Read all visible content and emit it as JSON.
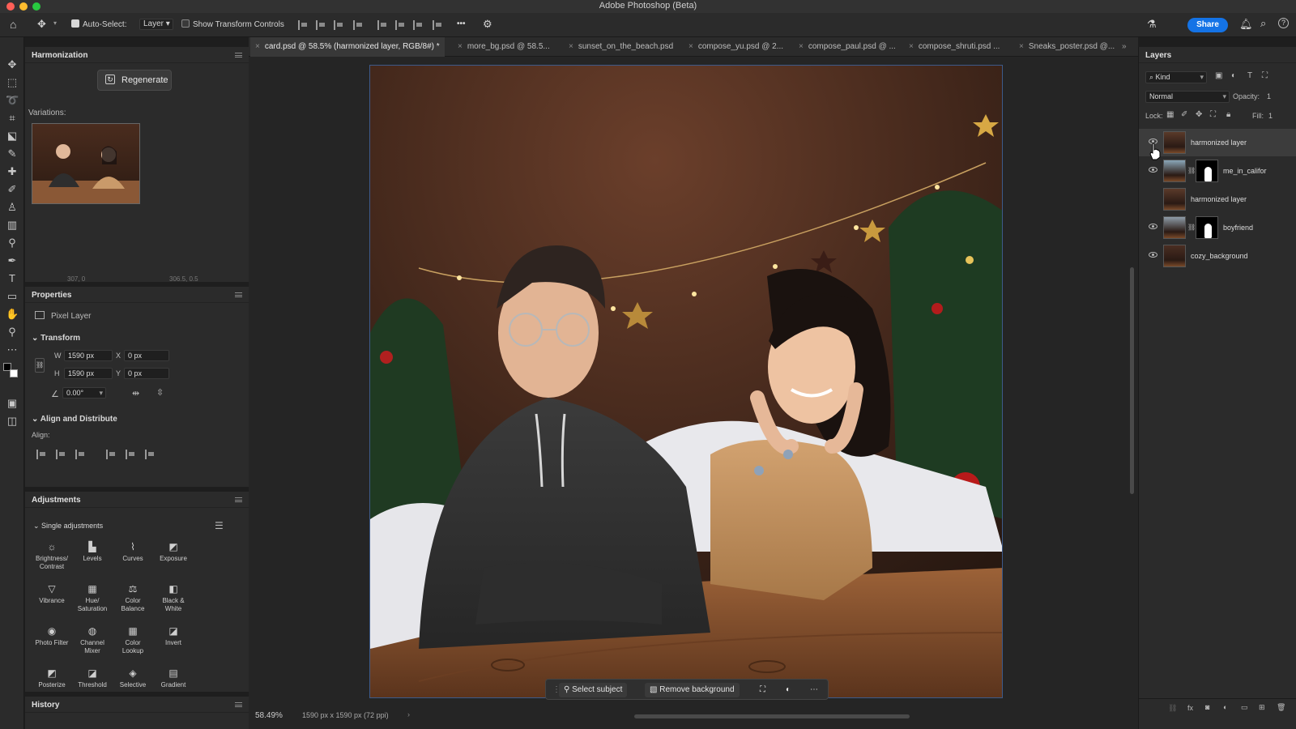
{
  "app": {
    "title": "Adobe Photoshop (Beta)"
  },
  "options": {
    "auto_select_label": "Auto-Select:",
    "auto_select_value": "Layer",
    "show_transform_label": "Show Transform Controls",
    "more": "•••",
    "share": "Share"
  },
  "tabs": [
    {
      "label": "card.psd @ 58.5% (harmonized layer, RGB/8#) *"
    },
    {
      "label": "more_bg.psd @ 58.5..."
    },
    {
      "label": "sunset_on_the_beach.psd"
    },
    {
      "label": "compose_yu.psd @ 2..."
    },
    {
      "label": "compose_paul.psd @ ..."
    },
    {
      "label": "compose_shruti.psd ..."
    },
    {
      "label": "Sneaks_poster.psd @..."
    }
  ],
  "harmonization": {
    "title": "Harmonization",
    "regenerate": "Regenerate",
    "variations": "Variations:",
    "coord_left": "307, 0",
    "coord_right": "306.5, 0.5"
  },
  "properties": {
    "title": "Properties",
    "layer_type": "Pixel Layer",
    "transform": "Transform",
    "w_label": "W",
    "w_value": "1590 px",
    "x_label": "X",
    "x_value": "0 px",
    "h_label": "H",
    "h_value": "1590 px",
    "y_label": "Y",
    "y_value": "0 px",
    "angle": "0.00°",
    "align_distribute": "Align and Distribute",
    "align": "Align:"
  },
  "adjustments": {
    "title": "Adjustments",
    "single": "Single adjustments",
    "items": [
      {
        "label": "Brightness/\nContrast",
        "icon": "☼"
      },
      {
        "label": "Levels",
        "icon": "▙"
      },
      {
        "label": "Curves",
        "icon": "⌇"
      },
      {
        "label": "Exposure",
        "icon": "◩"
      },
      {
        "label": "Vibrance",
        "icon": "▽"
      },
      {
        "label": "Hue/\nSaturation",
        "icon": "▦"
      },
      {
        "label": "Color\nBalance",
        "icon": "⚖"
      },
      {
        "label": "Black &\nWhite",
        "icon": "◧"
      },
      {
        "label": "Photo Filter",
        "icon": "◉"
      },
      {
        "label": "Channel\nMixer",
        "icon": "◍"
      },
      {
        "label": "Color\nLookup",
        "icon": "▦"
      },
      {
        "label": "Invert",
        "icon": "◪"
      },
      {
        "label": "Posterize",
        "icon": "◩"
      },
      {
        "label": "Threshold",
        "icon": "◪"
      },
      {
        "label": "Selective",
        "icon": "◈"
      },
      {
        "label": "Gradient",
        "icon": "▤"
      }
    ]
  },
  "history": {
    "title": "History"
  },
  "context_bar": {
    "select_subject": "Select subject",
    "remove_background": "Remove background"
  },
  "status": {
    "zoom": "58.49%",
    "doc_info": "1590 px x 1590 px (72 ppi)"
  },
  "layers": {
    "title": "Layers",
    "kind": "Kind",
    "blend": "Normal",
    "opacity_label": "Opacity:",
    "opacity_value": "1",
    "lock_label": "Lock:",
    "fill_label": "Fill:",
    "fill_value": "1",
    "items": [
      {
        "name": "harmonized layer",
        "visible": true,
        "mask": false,
        "selected": true
      },
      {
        "name": "me_in_califor",
        "visible": true,
        "mask": true,
        "selected": false
      },
      {
        "name": "harmonized layer",
        "visible": false,
        "mask": false,
        "selected": false
      },
      {
        "name": "boyfriend",
        "visible": true,
        "mask": true,
        "selected": false
      },
      {
        "name": "cozy_background",
        "visible": true,
        "mask": false,
        "selected": false
      }
    ]
  },
  "colors": {
    "accent": "#1473e6",
    "panel": "#2b2b2b",
    "canvas_bg": "#252525"
  }
}
